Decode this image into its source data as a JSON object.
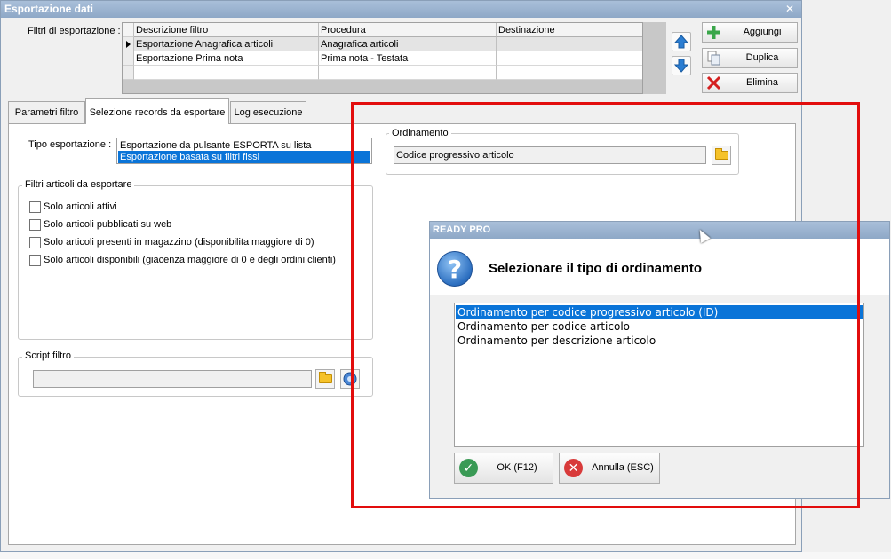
{
  "window": {
    "title": "Esportazione dati",
    "close_glyph": "✕"
  },
  "filters": {
    "label": "Filtri di esportazione :",
    "columns": [
      "Descrizione filtro",
      "Procedura",
      "Destinazione"
    ],
    "rows": [
      {
        "descrizione": "Esportazione Anagrafica articoli",
        "procedura": "Anagrafica articoli",
        "destinazione": ""
      },
      {
        "descrizione": "Esportazione Prima nota",
        "procedura": "Prima nota - Testata",
        "destinazione": ""
      }
    ]
  },
  "actions": {
    "add": "Aggiungi",
    "duplicate": "Duplica",
    "delete": "Elimina"
  },
  "tabs": [
    "Parametri filtro",
    "Selezione records da esportare",
    "Log esecuzione"
  ],
  "tipo_esportazione": {
    "label": "Tipo esportazione :",
    "options": [
      "Esportazione da pulsante ESPORTA su lista",
      "Esportazione basata su filtri fissi"
    ],
    "selected_index": 1
  },
  "filtri_articoli": {
    "title": "Filtri articoli da esportare",
    "checkboxes": [
      {
        "label": "Solo articoli attivi",
        "checked": false
      },
      {
        "label": "Solo articoli pubblicati su web",
        "checked": false
      },
      {
        "label": "Solo articoli presenti in magazzino (disponibilita maggiore di 0)",
        "checked": false
      },
      {
        "label": "Solo articoli disponibili (giacenza maggiore di 0 e degli ordini clienti)",
        "checked": false
      }
    ]
  },
  "script_filtro": {
    "title": "Script filtro",
    "value": ""
  },
  "ordinamento": {
    "title": "Ordinamento",
    "value": "Codice progressivo articolo"
  },
  "dialog": {
    "title": "READY PRO",
    "heading": "Selezionare il tipo di ordinamento",
    "options": [
      "Ordinamento per codice progressivo articolo (ID)",
      "Ordinamento per codice articolo",
      "Ordinamento per descrizione articolo"
    ],
    "selected_index": 0,
    "ok": "OK (F12)",
    "cancel": "Annulla (ESC)"
  },
  "colors": {
    "selection": "#0a74d8",
    "highlight_frame": "#e20d0d",
    "title_bar": "#9db4d1"
  }
}
